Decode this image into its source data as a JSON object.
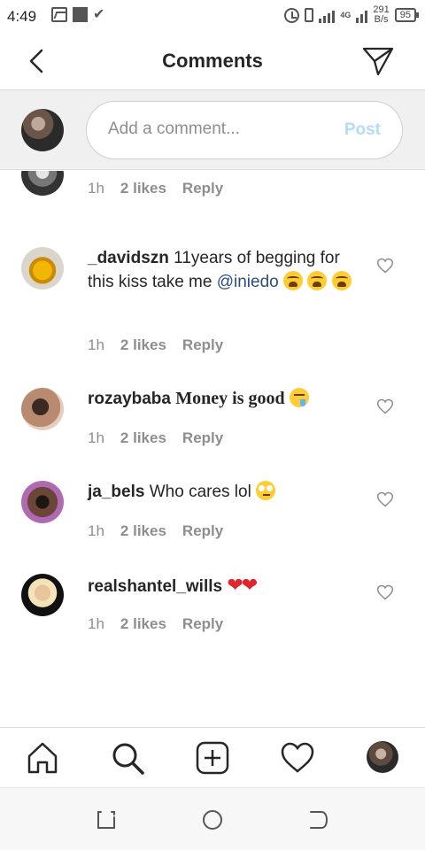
{
  "status_bar": {
    "time": "4:49",
    "network_type": "4G",
    "speed_value": "291",
    "speed_unit": "B/s",
    "battery": "95"
  },
  "header": {
    "title": "Comments",
    "back_icon": "chevron-left-icon",
    "send_icon": "paper-plane-icon"
  },
  "composer": {
    "placeholder": "Add a comment...",
    "value": "",
    "post_label": "Post",
    "post_color": "#b3dbff"
  },
  "comments": [
    {
      "username": "",
      "text": "",
      "time": "1h",
      "likes": "2 likes",
      "reply": "Reply"
    },
    {
      "username": "_davidszn",
      "text": "11years of begging for this kiss take me",
      "mention": "@iniedo",
      "emojis": [
        "weary-face",
        "weary-face",
        "weary-face"
      ],
      "time": "1h",
      "likes": "2 likes",
      "reply": "Reply"
    },
    {
      "username": "rozaybaba",
      "text": "Money is good",
      "emojis": [
        "drooling-face"
      ],
      "time": "1h",
      "likes": "2 likes",
      "reply": "Reply"
    },
    {
      "username": "ja_bels",
      "text": "Who cares lol",
      "emojis": [
        "face-with-rolling-eyes"
      ],
      "time": "1h",
      "likes": "2 likes",
      "reply": "Reply"
    },
    {
      "username": "realshantel_wills",
      "text": "",
      "emojis": [
        "red-heart",
        "red-heart"
      ],
      "time": "1h",
      "likes": "2 likes",
      "reply": "Reply"
    }
  ],
  "bottom_nav": {
    "items": [
      "home-icon",
      "search-icon",
      "add-post-icon",
      "activity-heart-icon",
      "profile-avatar"
    ]
  },
  "system_nav": {
    "items": [
      "recents-icon",
      "home-circle-icon",
      "back-icon"
    ]
  },
  "colors": {
    "mention": "#2b4d84",
    "meta_text": "#8e8e8e",
    "divider": "#dbdbdb",
    "composer_bg": "#f0f0f0"
  }
}
